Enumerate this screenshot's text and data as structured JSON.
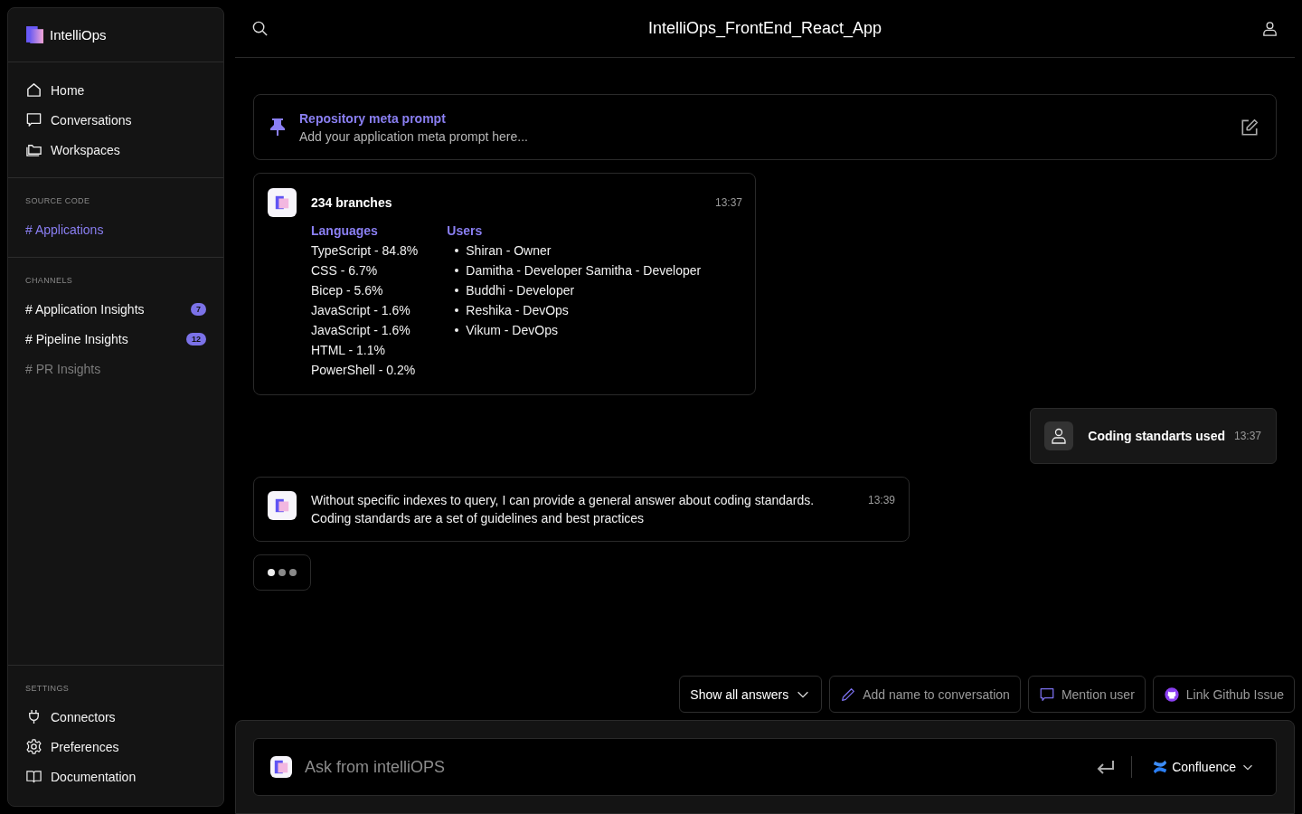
{
  "sidebar": {
    "brand": "IntelliOps",
    "nav": [
      {
        "label": "Home"
      },
      {
        "label": "Conversations"
      },
      {
        "label": "Workspaces"
      }
    ],
    "source_code": {
      "heading": "SOURCE CODE",
      "items": [
        {
          "label": "# Applications",
          "selected": true
        }
      ]
    },
    "channels": {
      "heading": "CHANNELS",
      "items": [
        {
          "label": "# Application Insights",
          "badge": "7",
          "muted": false
        },
        {
          "label": "# Pipeline Insights",
          "badge": "12",
          "muted": false
        },
        {
          "label": "# PR Insights",
          "muted": true
        }
      ]
    },
    "settings": {
      "heading": "SETTINGS",
      "items": [
        {
          "label": "Connectors"
        },
        {
          "label": "Preferences"
        },
        {
          "label": "Documentation"
        }
      ]
    }
  },
  "header": {
    "title": "IntelliOps_FrontEnd_React_App"
  },
  "meta_prompt": {
    "title": "Repository meta prompt",
    "placeholder": "Add your application meta prompt here..."
  },
  "messages": [
    {
      "kind": "stats",
      "title": "234 branches",
      "time": "13:37",
      "languages_heading": "Languages",
      "languages": [
        "TypeScript - 84.8%",
        "CSS - 6.7%",
        "Bicep - 5.6%",
        "JavaScript - 1.6%",
        "JavaScript - 1.6%",
        "HTML - 1.1%",
        "PowerShell - 0.2%"
      ],
      "users_heading": "Users",
      "users": [
        "Shiran - Owner",
        "Damitha - Developer Samitha - Developer",
        "Buddhi - Developer",
        "Reshika - DevOps",
        "Vikum - DevOps"
      ]
    },
    {
      "kind": "user",
      "text": "Coding standarts used",
      "time": "13:37"
    },
    {
      "kind": "bot",
      "text": "Without specific indexes to query, I can provide a general answer about coding standards. Coding standards are a set of guidelines and best practices",
      "time": "13:39"
    },
    {
      "kind": "typing"
    }
  ],
  "actions": [
    {
      "label": "Show all answers",
      "kind": "dropdown"
    },
    {
      "label": "Add name to conversation",
      "kind": "rename"
    },
    {
      "label": "Mention user",
      "kind": "mention"
    },
    {
      "label": "Link Github Issue",
      "kind": "github"
    }
  ],
  "composer": {
    "placeholder": "Ask from intelliOPS",
    "source": "Confluence"
  }
}
